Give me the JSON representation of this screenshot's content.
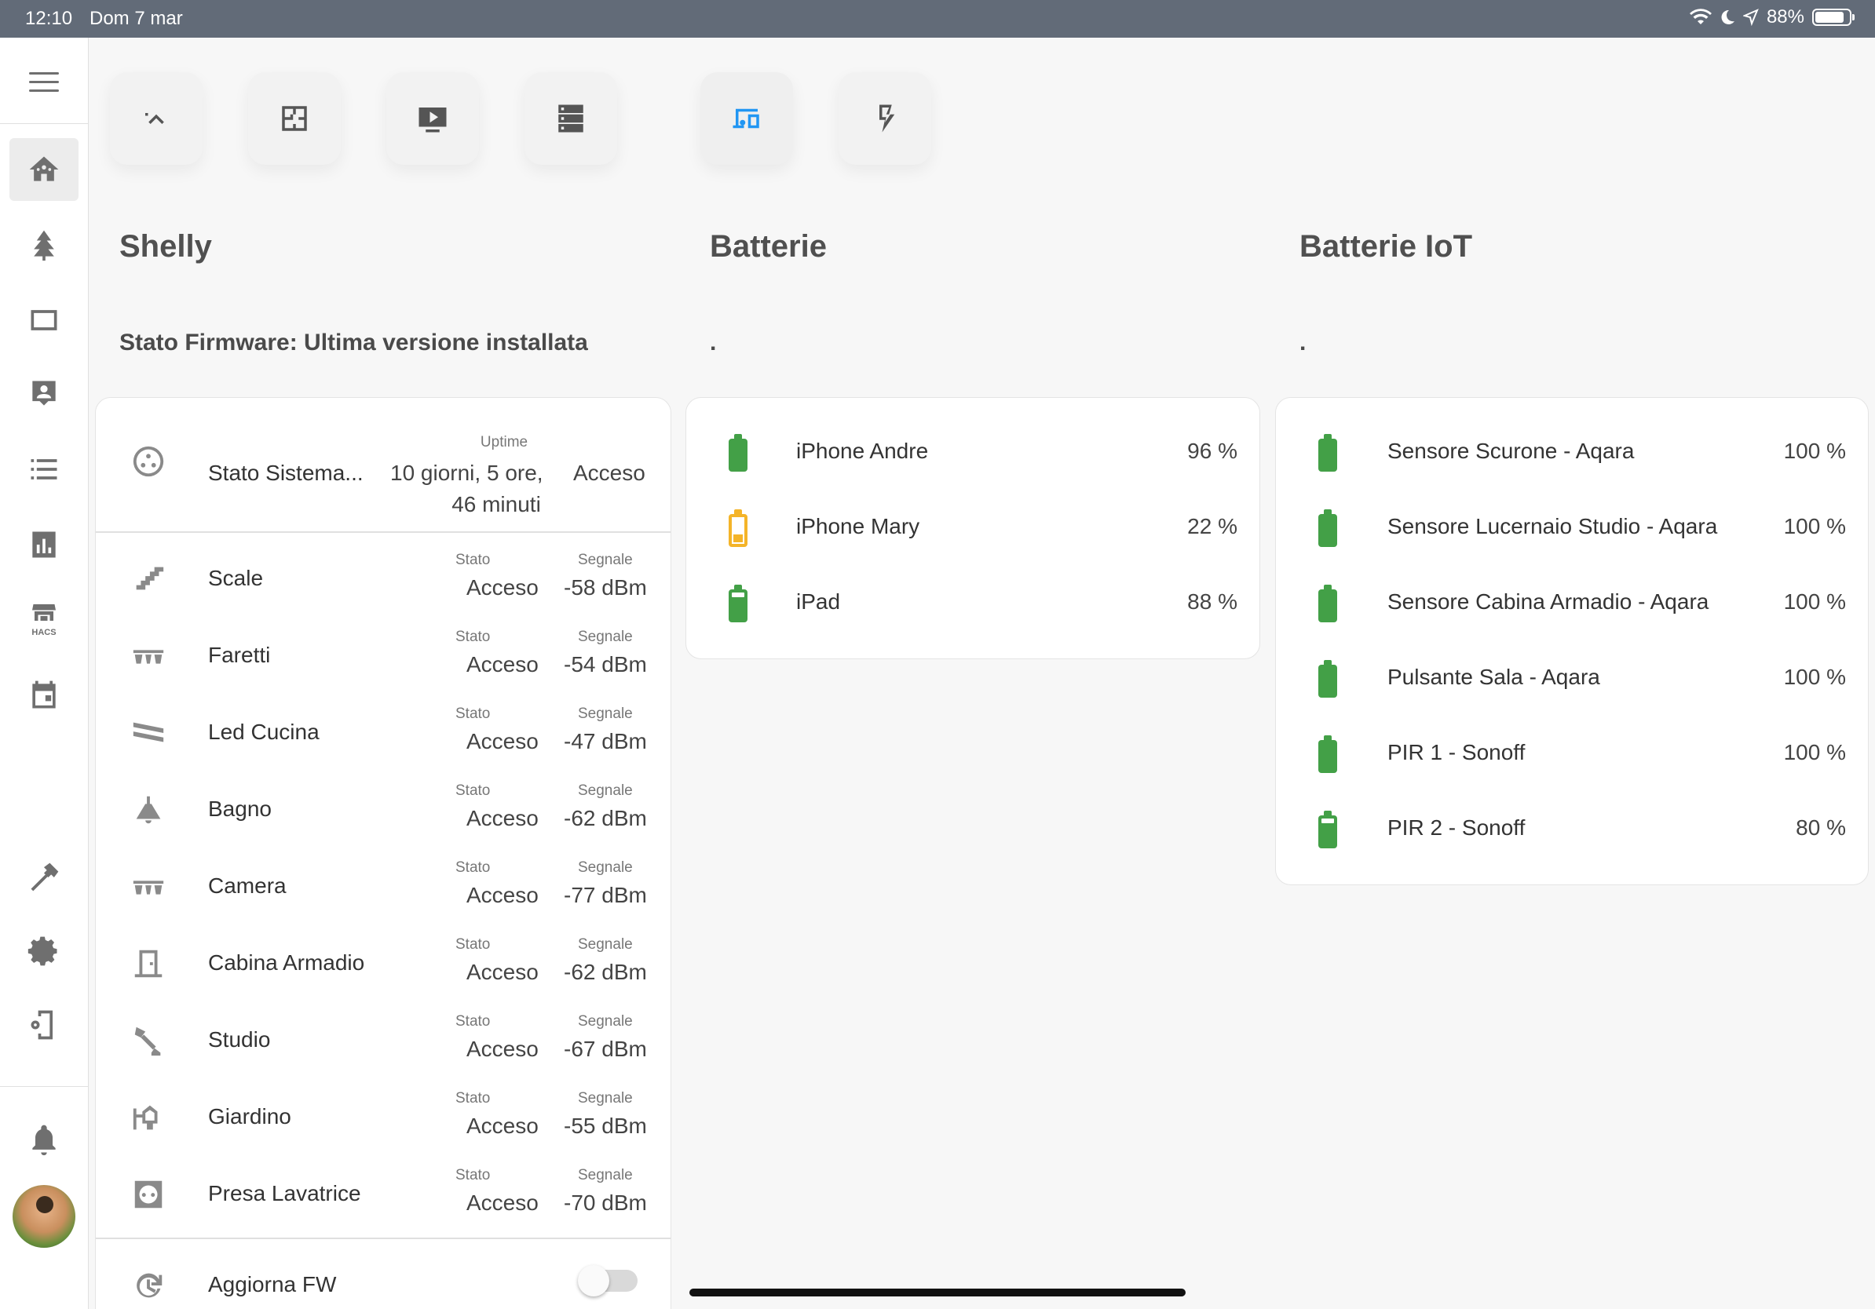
{
  "status_bar": {
    "time": "12:10",
    "date": "Dom 7 mar",
    "battery": "88%"
  },
  "sidebar": {
    "items": [
      "home-dashboard",
      "tree",
      "tablet",
      "person-card",
      "list",
      "chart",
      "hacs",
      "calendar",
      "hammer",
      "settings",
      "device-settings",
      "notifications"
    ],
    "hacs_label": "HACS"
  },
  "toolbar": {
    "tabs": [
      "chevron-up",
      "floorplan",
      "media",
      "server",
      "devices",
      "energy"
    ],
    "active_tab": "devices"
  },
  "columns": {
    "shelly": {
      "title": "Shelly",
      "subtitle": "Stato Firmware: Ultima versione installata"
    },
    "batterie": {
      "title": "Batterie",
      "subtitle": "."
    },
    "batterie_iot": {
      "title": "Batterie IoT",
      "subtitle": "."
    }
  },
  "shelly": {
    "system": {
      "name": "Stato Sistema...",
      "uptime_label": "Uptime",
      "uptime_line1": "10 giorni, 5 ore,",
      "uptime_line2": "46 minuti",
      "state": "Acceso"
    },
    "labels": {
      "stato": "Stato",
      "segnale": "Segnale"
    },
    "rows": [
      {
        "name": "Scale",
        "stato": "Acceso",
        "segnale": "-58 dBm",
        "icon": "stairs-icon"
      },
      {
        "name": "Faretti",
        "stato": "Acceso",
        "segnale": "-54 dBm",
        "icon": "spotlights-icon"
      },
      {
        "name": "Led Cucina",
        "stato": "Acceso",
        "segnale": "-47 dBm",
        "icon": "led-strip-icon"
      },
      {
        "name": "Bagno",
        "stato": "Acceso",
        "segnale": "-62 dBm",
        "icon": "ceiling-light-icon"
      },
      {
        "name": "Camera",
        "stato": "Acceso",
        "segnale": "-77 dBm",
        "icon": "spotlights-icon"
      },
      {
        "name": "Cabina Armadio",
        "stato": "Acceso",
        "segnale": "-62 dBm",
        "icon": "door-icon"
      },
      {
        "name": "Studio",
        "stato": "Acceso",
        "segnale": "-67 dBm",
        "icon": "desk-lamp-icon"
      },
      {
        "name": "Giardino",
        "stato": "Acceso",
        "segnale": "-55 dBm",
        "icon": "outdoor-lamp-icon"
      },
      {
        "name": "Presa Lavatrice",
        "stato": "Acceso",
        "segnale": "-70 dBm",
        "icon": "power-socket-icon"
      }
    ],
    "fw_update": {
      "name": "Aggiorna FW",
      "on": false
    }
  },
  "batterie": [
    {
      "name": "iPhone Andre",
      "value": "96 %",
      "level": 96,
      "color": "#43a047"
    },
    {
      "name": "iPhone Mary",
      "value": "22 %",
      "level": 22,
      "color": "#f4b429"
    },
    {
      "name": "iPad",
      "value": "88 %",
      "level": 88,
      "color": "#43a047"
    }
  ],
  "batterie_iot": [
    {
      "name": "Sensore Scurone - Aqara",
      "value": "100 %",
      "level": 100
    },
    {
      "name": "Sensore Lucernaio Studio - Aqara",
      "value": "100 %",
      "level": 100
    },
    {
      "name": "Sensore Cabina Armadio - Aqara",
      "value": "100 %",
      "level": 100
    },
    {
      "name": "Pulsante Sala - Aqara",
      "value": "100 %",
      "level": 100
    },
    {
      "name": "PIR 1 - Sonoff",
      "value": "100 %",
      "level": 100
    },
    {
      "name": "PIR 2 - Sonoff",
      "value": "80 %",
      "level": 80
    }
  ]
}
